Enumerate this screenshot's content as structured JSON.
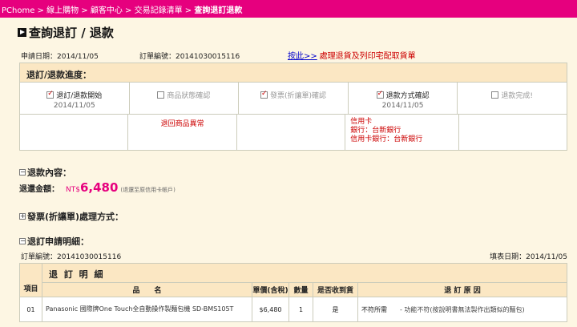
{
  "breadcrumb": {
    "items": [
      "PChome",
      "線上購物",
      "顧客中心",
      "交易記錄清單"
    ],
    "separator": " > ",
    "current": "查詢退訂退款"
  },
  "page_title": "查詢退訂 / 退款",
  "meta": {
    "apply_date": "申請日期：2014/11/05",
    "order_no": "訂單編號：20141030015116",
    "link_text": "按此>>",
    "link_desc": "處理退貨及列印宅配取貨單"
  },
  "progress": {
    "title": "退訂/退款進度：",
    "steps": [
      {
        "label": "退訂/退款開始",
        "date": "2014/11/05",
        "checked": true
      },
      {
        "label": "商品狀態確認",
        "date": "",
        "checked": false
      },
      {
        "label": "發票(折讓單)確認",
        "date": "",
        "checked": true
      },
      {
        "label": "退款方式確認",
        "date": "2014/11/05",
        "checked": true
      },
      {
        "label": "退款完成!",
        "date": "",
        "checked": false
      }
    ],
    "notes": {
      "step2": "退回商品異常",
      "step4_line1": "信用卡",
      "step4_line2": "銀行：台新銀行",
      "step4_line3": "信用卡銀行：台新銀行"
    }
  },
  "sections": {
    "refund_content": "退款內容：",
    "invoice": "發票(折讓單)處理方式：",
    "detail": "退訂申請明細："
  },
  "refund": {
    "label": "退還金額：",
    "currency": "NT$",
    "amount": "6,480",
    "note": "(退還至原信用卡帳戶)"
  },
  "detail": {
    "order_no": "訂單編號：20141030015116",
    "fill_date": "填表日期：2014/11/05",
    "title": "退 訂 明 細",
    "item_header": "項目",
    "columns": {
      "name": "品　　名",
      "price": "單價(含稅)",
      "qty": "數量",
      "received": "是否收到貨",
      "reason": "退 訂 原 因"
    },
    "rows": [
      {
        "item": "01",
        "name": "Panasonic 國際牌One Touch全自動操作製麵包機 SD-BMS105T",
        "price": "$6,480",
        "qty": "1",
        "received": "是",
        "reason": "不符所需",
        "reason_detail": "- 功能不符(按說明書無法製作出類似的麵包)"
      }
    ]
  }
}
